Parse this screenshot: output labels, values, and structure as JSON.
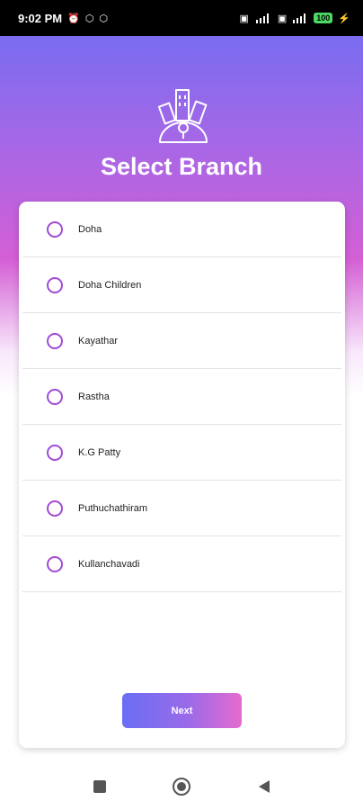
{
  "status_bar": {
    "time": "9:02 PM",
    "left_icons": [
      "alarm-icon",
      "app-notification-icon",
      "app-notification-icon"
    ],
    "right_icons": [
      "sim-icon",
      "signal-4g-icon",
      "sim-icon",
      "signal-icon",
      "charging-icon"
    ],
    "battery_level": "100"
  },
  "header": {
    "title": "Select Branch",
    "logo_icon": "city-globe-icon",
    "gradient_colors": [
      "#7a6cf0",
      "#d45fd5"
    ]
  },
  "branches": [
    {
      "label": "Doha",
      "selected": false
    },
    {
      "label": "Doha Children",
      "selected": false
    },
    {
      "label": "Kayathar",
      "selected": false
    },
    {
      "label": "Rastha",
      "selected": false
    },
    {
      "label": "K.G Patty",
      "selected": false
    },
    {
      "label": "Puthuchathiram",
      "selected": false
    },
    {
      "label": "Kullanchavadi",
      "selected": false
    }
  ],
  "actions": {
    "next_label": "Next"
  },
  "nav_bar": {
    "buttons": [
      "recent-apps-icon",
      "home-icon",
      "back-icon"
    ]
  },
  "colors": {
    "accent": "#a24ad6",
    "button_start": "#6a6ef5",
    "button_end": "#e66bcf"
  }
}
